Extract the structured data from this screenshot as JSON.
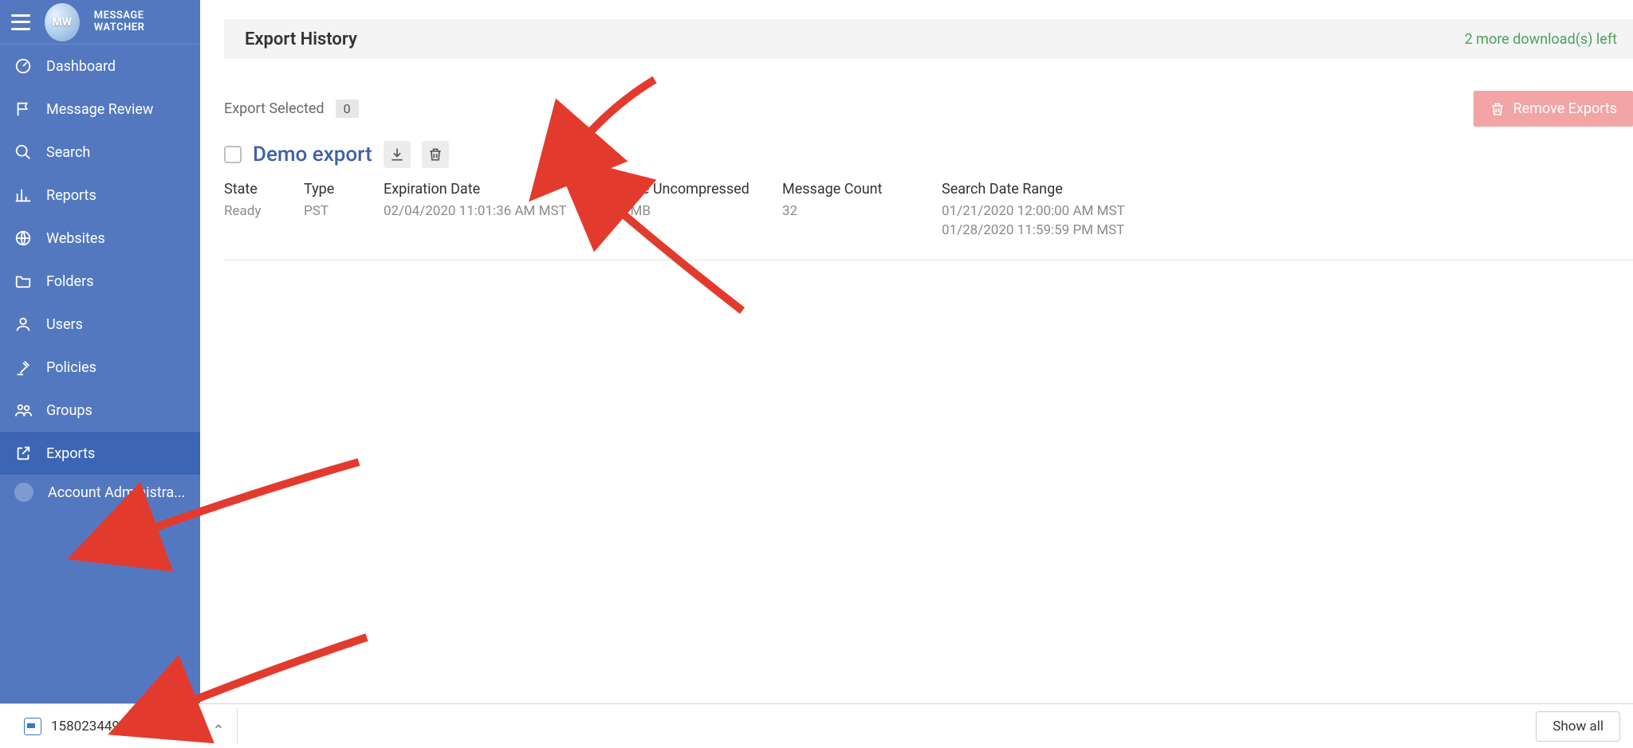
{
  "sidebar": {
    "app_title": "MESSAGE WATCHER",
    "logo_initials": "MW",
    "items": [
      {
        "label": "Dashboard",
        "icon": "speedometer-icon"
      },
      {
        "label": "Message Review",
        "icon": "flag-icon"
      },
      {
        "label": "Search",
        "icon": "search-icon"
      },
      {
        "label": "Reports",
        "icon": "bar-chart-icon"
      },
      {
        "label": "Websites",
        "icon": "globe-icon"
      },
      {
        "label": "Folders",
        "icon": "folder-icon"
      },
      {
        "label": "Users",
        "icon": "user-icon"
      },
      {
        "label": "Policies",
        "icon": "gavel-icon"
      },
      {
        "label": "Groups",
        "icon": "users-icon"
      },
      {
        "label": "Exports",
        "icon": "external-link-icon",
        "active": true
      },
      {
        "label": "Account Administra...",
        "icon": "avatar-icon"
      }
    ]
  },
  "header": {
    "title": "Export History",
    "downloads_left": "2 more download(s) left"
  },
  "actions": {
    "export_selected_label": "Export Selected",
    "selected_count": "0",
    "remove_exports_label": "Remove Exports"
  },
  "export": {
    "name": "Demo export",
    "columns": {
      "state_label": "State",
      "state_value": "Ready",
      "type_label": "Type",
      "type_value": "PST",
      "expiration_label": "Expiration Date",
      "expiration_value": "02/04/2020 11:01:36 AM MST",
      "size_label": "Size Uncompressed",
      "size_value": "2MB",
      "count_label": "Message Count",
      "count_value": "32",
      "range_label": "Search Date Range",
      "range_value_1": "01/21/2020 12:00:00 AM MST",
      "range_value_2": "01/28/2020 11:59:59 PM MST"
    }
  },
  "download_bar": {
    "filename": "1580234496788.de....pst",
    "show_all": "Show all"
  }
}
